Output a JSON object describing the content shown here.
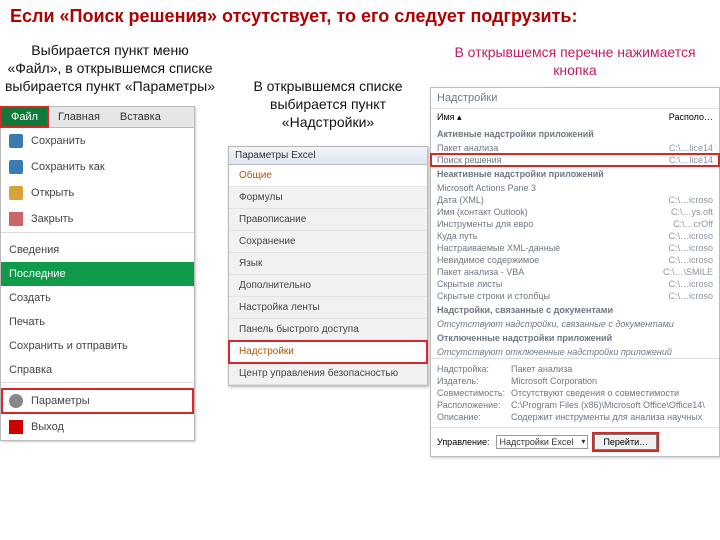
{
  "title": "Если «Поиск решения» отсутствует, то его следует подгрузить:",
  "left": {
    "caption": "Выбирается пункт меню «Файл», в открывшемся списке выбирается пункт «Параметры»",
    "tabs": {
      "file": "Файл",
      "home": "Главная",
      "insert": "Вставка"
    },
    "items": {
      "save": "Сохранить",
      "saveas": "Сохранить как",
      "open": "Открыть",
      "close": "Закрыть",
      "info": "Сведения",
      "recent": "Последние",
      "new": "Создать",
      "print": "Печать",
      "share": "Сохранить и отправить",
      "help": "Справка",
      "opts": "Параметры",
      "exit": "Выход"
    }
  },
  "center": {
    "caption": "В открывшемся списке выбирается пункт «Надстройки»",
    "dialog_title": "Параметры Excel",
    "items": {
      "general": "Общие",
      "formulas": "Формулы",
      "proof": "Правописание",
      "save": "Сохранение",
      "lang": "Язык",
      "advanced": "Дополнительно",
      "ribbon": "Настройка ленты",
      "qat": "Панель быстрого доступа",
      "addins": "Надстройки",
      "trust": "Центр управления безопасностью"
    }
  },
  "right": {
    "caption": "В открывшемся перечне нажимается кнопка",
    "title": "Надстройки",
    "head": {
      "name": "Имя ▴",
      "loc": "Располо…"
    },
    "sections": {
      "active": "Активные надстройки приложений",
      "inactive": "Неактивные надстройки приложений",
      "doc": "Надстройки, связанные с документами",
      "doc_none": "Отсутствуют надстройки, связанные с документами",
      "off": "Отключенные надстройки приложений",
      "off_none": "Отсутствуют отключенные надстройки приложений"
    },
    "rows": {
      "analysis": {
        "l": "Пакет анализа",
        "r": "C:\\…lice14"
      },
      "solver": {
        "l": "Поиск решения",
        "r": "C:\\…lice14"
      },
      "mapane": {
        "l": "Microsoft Actions Pane 3",
        "r": ""
      },
      "xml": {
        "l": "Дата (XML)",
        "r": "C:\\…icroso"
      },
      "outlook": {
        "l": "Имя (контакт Outlook)",
        "r": "C:\\…ys.oft"
      },
      "euro": {
        "l": "Инструменты для евро",
        "r": "C:\\…crOff"
      },
      "path": {
        "l": "Куда путь",
        "r": "C:\\…icroso"
      },
      "xmlcust": {
        "l": "Настраиваемые XML-данные",
        "r": "C:\\…icroso"
      },
      "invis": {
        "l": "Невидимое содержимое",
        "r": "C:\\…icroso"
      },
      "vba": {
        "l": "Пакет анализа - VBA",
        "r": "C:\\…\\SMILE"
      },
      "hidws": {
        "l": "Скрытые листы",
        "r": "C:\\…icroso"
      },
      "hidrc": {
        "l": "Скрытые строки и столбцы",
        "r": "C:\\…icroso"
      }
    },
    "desc": {
      "addin_l": "Надстройка:",
      "addin_v": "Пакет анализа",
      "pub_l": "Издатель:",
      "pub_v": "Microsoft Corporation",
      "compat_l": "Совместимость:",
      "compat_v": "Отсутствуют сведения о совместимости",
      "loc_l": "Расположение:",
      "loc_v": "C:\\Program Files (x86)\\Microsoft Office\\Office14\\",
      "about_l": "Описание:",
      "about_v": "Содержит инструменты для анализа научных"
    },
    "bottom": {
      "manage_l": "Управление:",
      "manage_v": "Надстройки Excel",
      "go": "Перейти…"
    }
  }
}
